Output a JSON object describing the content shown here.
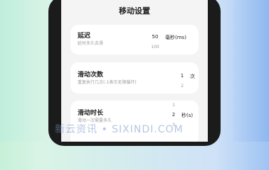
{
  "page": {
    "title": "移动设置"
  },
  "cards": [
    {
      "title": "延迟",
      "desc": "延时多久去滑",
      "picker": {
        "selected": "50",
        "next": "100"
      },
      "unit": "毫秒(ms)"
    },
    {
      "title": "滑动次数",
      "desc": "重复执行几次(-1表示无限循环)",
      "picker": {
        "selected": "1",
        "next": "2"
      },
      "unit": "次"
    },
    {
      "title": "滑动时长",
      "desc": "滑动一次需要多久",
      "picker": {
        "prev": "1",
        "selected": "2",
        "next": "3"
      },
      "unit": "秒(s)"
    }
  ],
  "watermark": "新云资讯 • SIXINDI.COM"
}
